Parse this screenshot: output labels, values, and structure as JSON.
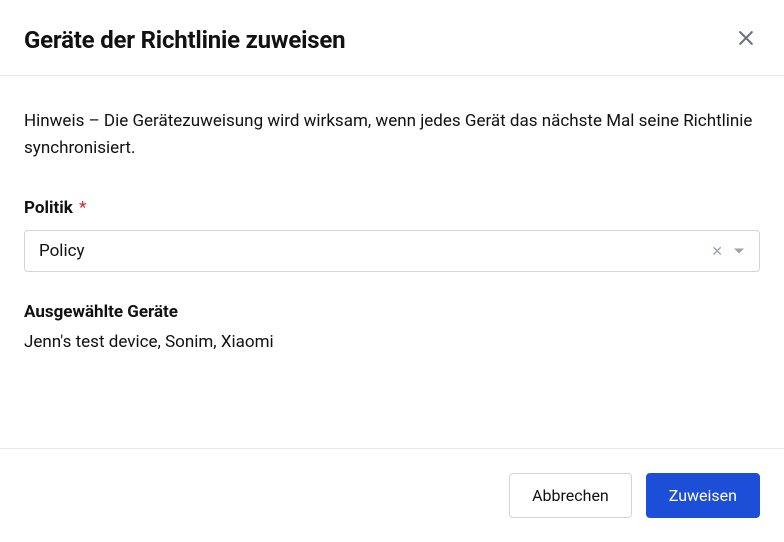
{
  "modal": {
    "title": "Geräte der Richtlinie zuweisen",
    "hint": "Hinweis – Die Gerätezuweisung wird wirksam, wenn jedes Gerät das nächste Mal seine Richtlinie synchronisiert.",
    "policy_label": "Politik",
    "required_mark": "*",
    "policy_value": "Policy",
    "devices_label": "Ausgewählte Geräte",
    "devices_list": "Jenn's test device, Sonim, Xiaomi"
  },
  "footer": {
    "cancel_label": "Abbrechen",
    "submit_label": "Zuweisen"
  }
}
